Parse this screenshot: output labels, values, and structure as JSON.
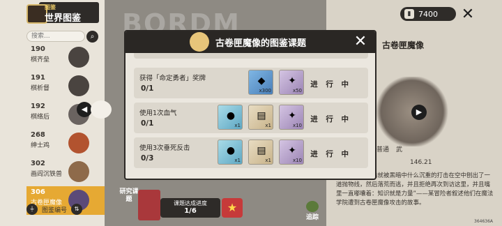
{
  "header": {
    "small_title": "图鉴",
    "title": "世界图鉴",
    "currency_value": "7400"
  },
  "watermark": "BORDM",
  "search": {
    "placeholder": "搜索..."
  },
  "list": [
    {
      "num": "190",
      "name": "棋齐垒"
    },
    {
      "num": "191",
      "name": "棋析督"
    },
    {
      "num": "192",
      "name": "棋络后"
    },
    {
      "num": "268",
      "name": "绅士鸡"
    },
    {
      "num": "302",
      "name": "画阎沉铁兽"
    },
    {
      "num": "306",
      "name": "古卷匣魔像",
      "selected": true
    }
  ],
  "footer": {
    "sort_label": "图鉴编号"
  },
  "right_panel": {
    "name": "古卷匣魔像",
    "tag1": "普通",
    "tag2": "武",
    "distance": "146.21",
    "description": "库的大门，随后就被黑暗中什么沉重的打击在空中刨出了一道抛物线，然后落荒而逃，并且拒绝再次到访这里，并且嘴里一直嘟囔着：知识就是力量”——某冒险者叙述他们在魔法学院遭到古卷匣魔像攻击的故事。",
    "coord_text": "364636A"
  },
  "bottom": {
    "research": "研究课题",
    "progress_label": "课题达成进度",
    "progress_value": "1/6",
    "track_label": "追踪"
  },
  "modal": {
    "title": "古卷匣魔像的图鉴课题",
    "tasks": [
      {
        "desc": "获得「命定勇者」奖牌",
        "progress": "0/1",
        "status": "进 行 中",
        "rewards": [
          {
            "kind": "blue",
            "icon": "prism-icon",
            "glyph": "◆",
            "count": "x300"
          },
          {
            "kind": "purple",
            "icon": "card-icon",
            "glyph": "✦",
            "count": "x50"
          }
        ]
      },
      {
        "desc": "使用1次血气",
        "progress": "0/1",
        "status": "进 行 中",
        "rewards": [
          {
            "kind": "cyan",
            "icon": "orb-icon",
            "glyph": "●",
            "count": "x1"
          },
          {
            "kind": "scroll",
            "icon": "scroll-icon",
            "glyph": "▤",
            "count": "x1"
          },
          {
            "kind": "purple",
            "icon": "card-icon",
            "glyph": "✦",
            "count": "x10"
          }
        ]
      },
      {
        "desc": "使用3次垂死反击",
        "progress": "0/3",
        "status": "进 行 中",
        "rewards": [
          {
            "kind": "cyan",
            "icon": "orb-icon",
            "glyph": "●",
            "count": "x1"
          },
          {
            "kind": "scroll",
            "icon": "scroll-icon",
            "glyph": "▤",
            "count": "x1"
          },
          {
            "kind": "purple",
            "icon": "card-icon",
            "glyph": "✦",
            "count": "x10"
          }
        ]
      }
    ]
  }
}
